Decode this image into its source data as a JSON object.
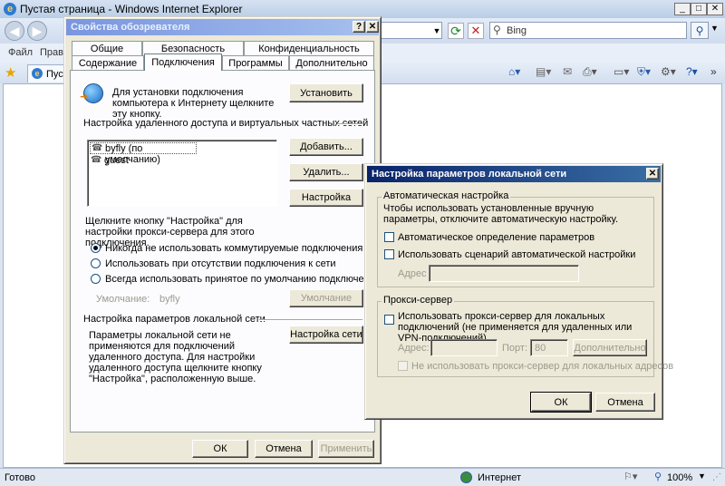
{
  "browser": {
    "title": "Пустая страница - Windows Internet Explorer",
    "search_placeholder": "Bing",
    "menu": [
      "Файл",
      "Правка"
    ],
    "tab_label": "Пуст",
    "status_text": "Готово",
    "zone_text": "Интернет",
    "zoom_text": "100%"
  },
  "ie_options": {
    "title": "Свойства обозревателя",
    "tabs_row1": [
      "Общие",
      "Безопасность",
      "Конфиденциальность"
    ],
    "tabs_row2": [
      "Содержание",
      "Подключения",
      "Программы",
      "Дополнительно"
    ],
    "setup_text": "Для установки подключения компьютера к Интернету щелкните эту кнопку.",
    "setup_button": "Установить",
    "dialup_section": "Настройка удаленного доступа и виртуальных частных сетей",
    "connections": [
      "byfly (по умолчанию)",
      "guest"
    ],
    "add_button": "Добавить...",
    "remove_button": "Удалить...",
    "settings_button": "Настройка",
    "proxy_hint": "Щелкните кнопку \"Настройка\" для настройки прокси-сервера для этого подключения.",
    "radio_options": [
      "Никогда не использовать коммутируемые подключения",
      "Использовать при отсутствии подключения к сети",
      "Всегда использовать принятое по умолчанию подключение"
    ],
    "default_label": "Умолчание:",
    "default_value": "byfly",
    "default_button": "Умолчание",
    "lan_section": "Настройка параметров локальной сети",
    "lan_text": "Параметры локальной сети не применяются для подключений удаленного доступа. Для настройки удаленного доступа щелкните кнопку \"Настройка\", расположенную выше.",
    "lan_button": "Настройка сети",
    "ok": "ОК",
    "cancel": "Отмена",
    "apply": "Применить"
  },
  "lan_dialog": {
    "title": "Настройка параметров локальной сети",
    "auto_group": "Автоматическая настройка",
    "auto_text": "Чтобы использовать установленные вручную параметры, отключите автоматическую настройку.",
    "auto_detect": "Автоматическое определение параметров",
    "auto_script": "Использовать сценарий автоматической настройки",
    "address_label": "Адрес",
    "proxy_group": "Прокси-сервер",
    "use_proxy": "Использовать прокси-сервер для локальных подключений (не применяется для удаленных или VPN-подключений).",
    "proxy_address_label": "Адрес:",
    "port_label": "Порт:",
    "port_value": "80",
    "advanced_button": "Дополнительно",
    "bypass_local": "Не использовать прокси-сервер для локальных адресов",
    "ok": "ОК",
    "cancel": "Отмена"
  },
  "colors": {
    "dialog_face": "#ece9d8",
    "title_active": "#0a246a",
    "title_inactive": "#7a96df"
  }
}
